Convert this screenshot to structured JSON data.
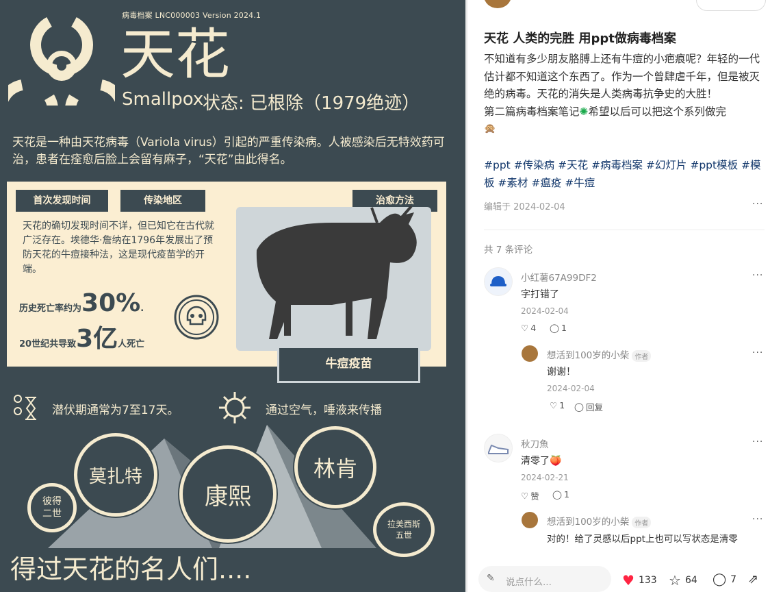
{
  "slide": {
    "header_top": "病毒档案  LNC000003  Version 2024.1",
    "title_cn": "天花",
    "title_en": "Smallpox",
    "status": "状态: 已根除（1979绝迹）",
    "intro": "天花是一种由天花病毒（Variola virus）引起的严重传染病。人被感染后无特效药可治，患者在痊愈后脸上会留有麻子，“天花”由此得名。",
    "tag_first_discovery": "首次发现时间",
    "tag_region": "传染地区",
    "tag_cure": "治愈方法",
    "panel_text": "天花的确切发现时间不详，但已知它在古代就广泛存在。埃德华·詹纳在1796年发展出了预防天花的牛痘接种法，这是现代疫苗学的开端。",
    "death_rate_prefix": "历史死亡率约为",
    "death_rate_value": "30%",
    "death_rate_suffix": ".",
    "deaths_prefix": "20世纪共导致",
    "deaths_value": "3亿",
    "deaths_suffix": "人死亡",
    "vaccine_label": "牛痘疫苗",
    "fact_incubation": "潜伏期通常为7至17天。",
    "fact_transmission": "通过空气，唾液来传播",
    "people": {
      "p1": "彼得二世",
      "p2": "莫扎特",
      "p3": "康熙",
      "p4": "林肯",
      "p5": "拉美西斯五世"
    },
    "famous_title": "得过天花的名人们...."
  },
  "post": {
    "title": "天花 人类的完胜 用ppt做病毒档案",
    "body_1": "不知道有多少朋友胳膊上还有牛痘的小疤痕呢？年轻的一代估计都不知道这个东西了。作为一个曾肆虐千年，但是被灭绝的病毒。天花的消失是人类病毒抗争史的大胜！",
    "body_2": "第二篇病毒档案笔记",
    "body_3": "希望以后可以把这个系列做完",
    "tags": "#ppt #传染病 #天花 #病毒档案 #幻灯片 #ppt模板 #模板 #素材 #瘟疫  #牛痘",
    "edited": "编辑于 2024-02-04",
    "comment_count": "共 7 条评论"
  },
  "comments": [
    {
      "name": "小红薯67A99DF2",
      "text": "字打错了",
      "date": "2024-02-04",
      "likes": "4",
      "replies": "1"
    },
    {
      "name": "想活到100岁的小柴",
      "badge": "作者",
      "text": "谢谢！",
      "date": "2024-02-04",
      "likes": "1",
      "reply_label": "回复"
    },
    {
      "name": "秋刀魚",
      "text": "清零了",
      "date": "2024-02-21",
      "likes": "赞",
      "replies": "1"
    },
    {
      "name": "想活到100岁的小柴",
      "badge": "作者",
      "text": "对的！给了灵感以后ppt上也可以写状态是清零"
    }
  ],
  "bottom": {
    "input_placeholder": "说点什么...",
    "likes": "133",
    "stars": "64",
    "comments": "7"
  },
  "colors": {
    "slide_bg": "#3c4a51",
    "cream": "#f5ebcf",
    "panel": "#fbeed2",
    "like_red": "#ff2442",
    "tag_blue": "#13386c"
  }
}
